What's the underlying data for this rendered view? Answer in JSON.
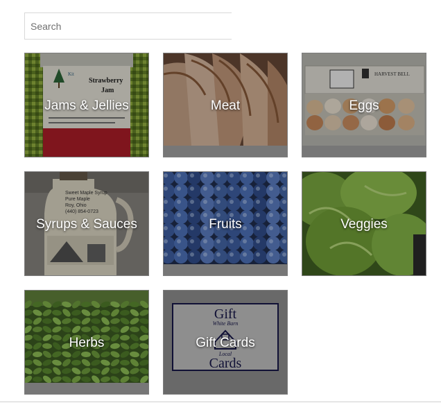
{
  "search": {
    "placeholder": "Search"
  },
  "categories": [
    {
      "label": "Jams & Jellies",
      "jar_brand": "Kit",
      "jar_title": "Strawberry",
      "jar_subtitle": "Jam"
    },
    {
      "label": "Meat"
    },
    {
      "label": "Eggs",
      "carton_text": "HARVEST BELL"
    },
    {
      "label": "Syrups & Sauces",
      "bottle_line1": "Sweet Maple Syrup",
      "bottle_line2": "Pure Maple",
      "bottle_line3": "Roy, Ohio",
      "bottle_line4": "(440) 854-0723"
    },
    {
      "label": "Fruits"
    },
    {
      "label": "Veggies"
    },
    {
      "label": "Herbs"
    },
    {
      "label": "Gift Cards",
      "card_top": "Gift",
      "card_mid1": "White Barn",
      "card_mid2": "Local",
      "card_bottom": "Cards"
    }
  ],
  "colors": {
    "tile_base": "#777777",
    "label_text": "#ffffff",
    "gift_card_border": "#1c1c5c"
  }
}
